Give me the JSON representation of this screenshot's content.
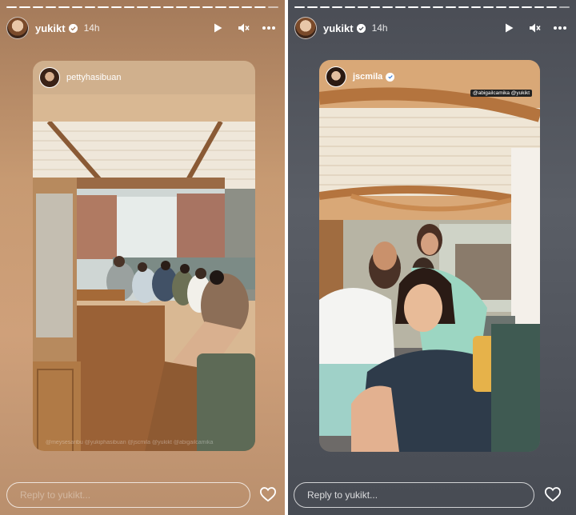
{
  "stories": [
    {
      "username": "yukikt",
      "time": "14h",
      "card_username": "pettyhasibuan",
      "card_tags": "@meysesaribu @yukiphasibuan @jscmila @yukikt @abigailcamika",
      "reply_placeholder": "Reply to yukikt..."
    },
    {
      "username": "yukikt",
      "time": "14h",
      "card_username": "jscmila",
      "card_tags": "@abigailcamika @yukikt",
      "reply_placeholder": "Reply to yukikt..."
    }
  ],
  "icons": {
    "verified": "verified-badge-icon",
    "play": "play-icon",
    "mute": "mute-icon",
    "more": "more-icon",
    "heart": "heart-icon"
  }
}
